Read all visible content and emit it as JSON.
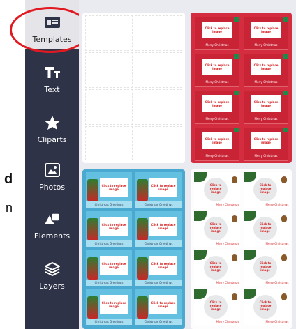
{
  "background_text": {
    "line1": "d",
    "line2": "n"
  },
  "sidebar": {
    "items": [
      {
        "label": "Templates",
        "icon": "templates-icon",
        "active": true
      },
      {
        "label": "Text",
        "icon": "text-icon"
      },
      {
        "label": "Cliparts",
        "icon": "star-icon"
      },
      {
        "label": "Photos",
        "icon": "photos-icon"
      },
      {
        "label": "Elements",
        "icon": "elements-icon"
      },
      {
        "label": "Layers",
        "icon": "layers-icon"
      }
    ]
  },
  "templates": {
    "placeholder_text": "Click to replace image",
    "red_footer": "Merry Christmas",
    "blue_footer": "Christmas Greetings",
    "white_footer": "Merry Christmas"
  },
  "colors": {
    "sidebar": "#2e3348",
    "highlight": "#e11a22",
    "red_template": "#d42d3f",
    "blue_template": "#4aa9d0"
  }
}
